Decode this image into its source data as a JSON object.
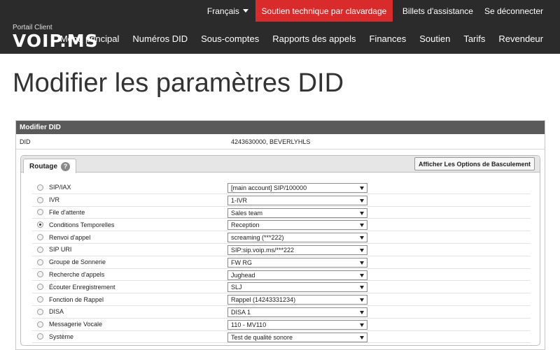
{
  "header": {
    "language": "Français",
    "chat_support": "Soutien technique par clavardage",
    "tickets": "Billets d'assistance",
    "logout": "Se déconnecter",
    "logo_sub": "Portail Client",
    "logo_word": "VOIP.MS",
    "nav": [
      "Menu principal",
      "Numéros DID",
      "Sous-comptes",
      "Rapports des appels",
      "Finances",
      "Soutien",
      "Tarifs",
      "Revendeur"
    ]
  },
  "page": {
    "title": "Modifier les paramètres DID"
  },
  "panel": {
    "heading": "Modifier DID",
    "did_label": "DID",
    "did_value": "4243630000, BEVERLYHLS",
    "tab_label": "Routage",
    "toggle_button": "Afficher Les Options de Basculement"
  },
  "routing": [
    {
      "label": "SIP/IAX",
      "value": "[main account] SIP/100000",
      "selected": false
    },
    {
      "label": "IVR",
      "value": "1-IVR",
      "selected": false
    },
    {
      "label": "File d'attente",
      "value": "Sales team",
      "selected": false
    },
    {
      "label": "Conditions Temporelles",
      "value": "Reception",
      "selected": true
    },
    {
      "label": "Renvoi d'appel",
      "value": "screaming (***222)",
      "selected": false
    },
    {
      "label": "SIP URI",
      "value": "SIP:sip.voip.ms/***222",
      "selected": false
    },
    {
      "label": "Groupe de Sonnerie",
      "value": "FW RG",
      "selected": false
    },
    {
      "label": "Recherche d'appels",
      "value": "Jughead",
      "selected": false
    },
    {
      "label": "Écouter Enregistrement",
      "value": "SLJ",
      "selected": false
    },
    {
      "label": "Fonction de Rappel",
      "value": "Rappel (14243331234)",
      "selected": false
    },
    {
      "label": "DISA",
      "value": "DISA 1",
      "selected": false
    },
    {
      "label": "Messagerie Vocale",
      "value": "110 - MV110",
      "selected": false
    },
    {
      "label": "Système",
      "value": "Test de qualité sonore",
      "selected": false
    }
  ],
  "colors": {
    "header_bg": "#2b2b2b",
    "accent": "#d92b2b",
    "panel_head": "#5a5a5a"
  }
}
